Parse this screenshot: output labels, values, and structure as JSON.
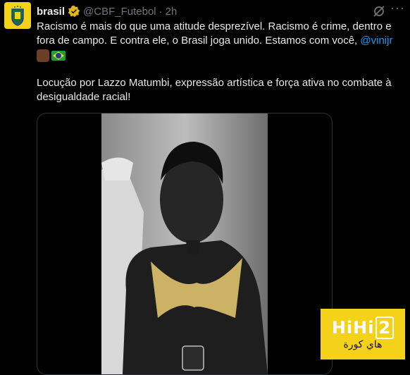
{
  "tweet": {
    "author_name": "brasil",
    "handle": "@CBF_Futebol",
    "separator": "·",
    "time": "2h",
    "more_label": "···",
    "text_line1": "Racismo é mais do que uma atitude desprezível. Racismo é crime, dentro e fora de campo. E contra ele, o Brasil joga unido. Estamos com você, ",
    "mention": "@vinijr",
    "text_line2": "Locução por Lazzo Matumbi, expressão artística e força ativa no combate à desigualdade racial!"
  },
  "colors": {
    "accent": "#1d9bf0",
    "brand": "#f4d21a",
    "background": "#000000",
    "muted": "#71767b"
  },
  "icons": [
    "cbf-crest-icon",
    "verified-badge-icon",
    "grok-icon",
    "more-icon",
    "raised-fist-emoji",
    "brazil-flag-emoji"
  ],
  "watermark": {
    "main": "HiHi",
    "num": "2",
    "sub": "هاي كورة"
  }
}
